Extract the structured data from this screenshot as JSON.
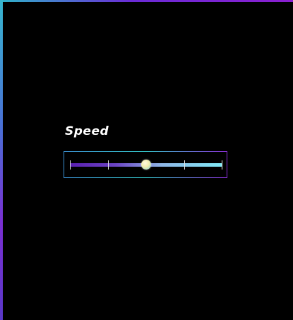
{
  "slider": {
    "label": "Speed",
    "value_fraction": 0.5,
    "tick_count": 5
  },
  "colors": {
    "background": "#000000",
    "frame_cyan": "#37b7cf",
    "frame_purple": "#7a2fd2",
    "track_start": "#5a1fb0",
    "track_end": "#7fe9f5",
    "thumb": "#f1eeb0"
  }
}
